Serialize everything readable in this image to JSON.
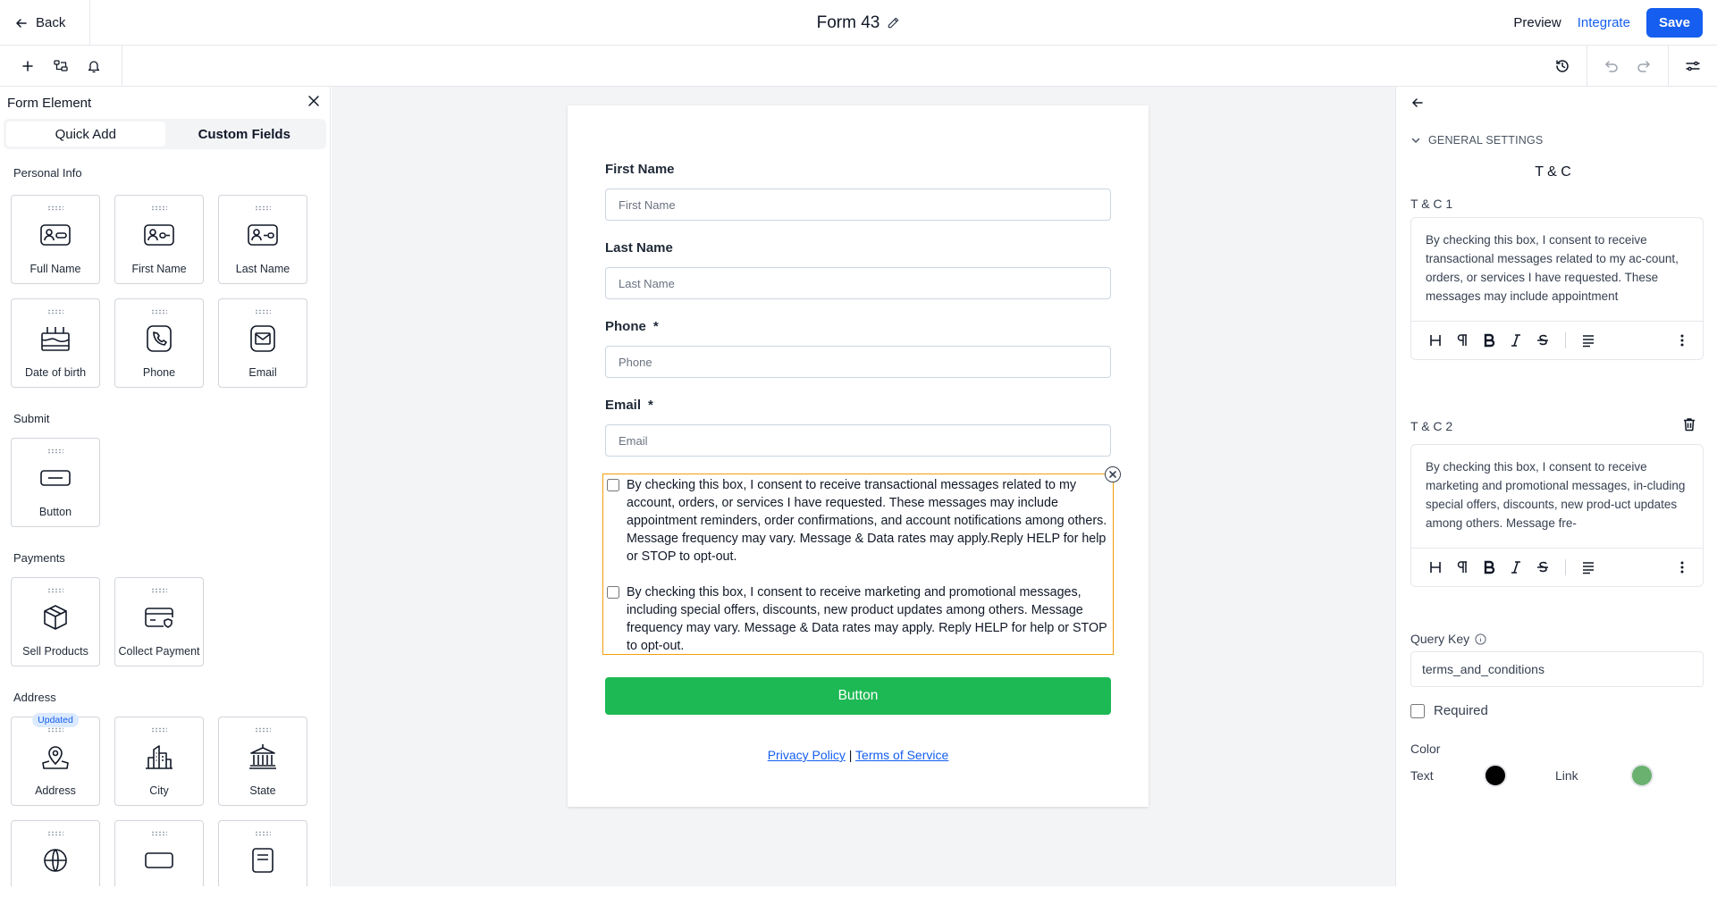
{
  "header": {
    "back_label": "Back",
    "form_title": "Form 43",
    "preview_label": "Preview",
    "integrate_label": "Integrate",
    "save_label": "Save"
  },
  "toolbar": {
    "left_icons": [
      "plus-icon",
      "layers-icon",
      "bell-icon"
    ],
    "right_icons": [
      "history-icon",
      "undo-icon",
      "redo-icon",
      "settings-sliders-icon"
    ]
  },
  "left_panel": {
    "title": "Form Element",
    "tabs": [
      {
        "label": "Quick Add",
        "active": true
      },
      {
        "label": "Custom Fields",
        "active": false
      }
    ],
    "sections": [
      {
        "label": "Personal Info",
        "items": [
          {
            "label": "Full Name",
            "icon": "id-card-icon"
          },
          {
            "label": "First Name",
            "icon": "id-card-icon"
          },
          {
            "label": "Last Name",
            "icon": "id-card-icon"
          },
          {
            "label": "Date of birth",
            "icon": "cake-icon"
          },
          {
            "label": "Phone",
            "icon": "phone-icon"
          },
          {
            "label": "Email",
            "icon": "mail-icon"
          }
        ]
      },
      {
        "label": "Submit",
        "items": [
          {
            "label": "Button",
            "icon": "button-icon"
          }
        ]
      },
      {
        "label": "Payments",
        "items": [
          {
            "label": "Sell Products",
            "icon": "box-icon"
          },
          {
            "label": "Collect Payment",
            "icon": "credit-card-icon"
          }
        ]
      },
      {
        "label": "Address",
        "items": [
          {
            "label": "Address",
            "icon": "map-pin-icon",
            "badge": "Updated"
          },
          {
            "label": "City",
            "icon": "city-icon"
          },
          {
            "label": "State",
            "icon": "landmark-icon"
          }
        ]
      }
    ]
  },
  "form": {
    "fields": [
      {
        "label": "First Name",
        "placeholder": "First Name",
        "required": false
      },
      {
        "label": "Last Name",
        "placeholder": "Last Name",
        "required": false
      },
      {
        "label": "Phone",
        "placeholder": "Phone",
        "required": true
      },
      {
        "label": "Email",
        "placeholder": "Email",
        "required": true
      }
    ],
    "required_marker": "*",
    "consents": [
      "By checking this box, I consent to receive transactional messages related to my account, orders, or services I have requested. These messages may include appointment reminders, order confirmations, and account notifications among others. Message frequency may vary. Message & Data rates may apply.Reply HELP for help or STOP to opt-out.",
      "By checking this box, I consent to receive marketing and promotional messages, including special offers, discounts, new product updates among others. Message frequency may vary. Message & Data rates may apply. Reply HELP for help or STOP to opt-out."
    ],
    "submit_label": "Button",
    "privacy_link": "Privacy Policy",
    "link_separator": "|",
    "terms_link": "Terms of Service"
  },
  "right_panel": {
    "section_label": "GENERAL SETTINGS",
    "heading": "T & C",
    "tc1": {
      "label": "T & C 1",
      "text": "By checking this box, I consent to receive transactional messages related to my ac-count, orders, or services I have requested. These messages may include appointment"
    },
    "tc2": {
      "label": "T & C 2",
      "text": "By checking this box, I consent to receive marketing and promotional messages, in-cluding special offers, discounts, new prod-uct updates among others. Message fre-"
    },
    "query_key_label": "Query Key",
    "query_key_value": "terms_and_conditions",
    "required_label": "Required",
    "color_label": "Color",
    "text_color_label": "Text",
    "link_color_label": "Link",
    "text_color": "#000000",
    "link_color": "#6ab06f"
  },
  "colors": {
    "accent": "#155eef",
    "submit_button": "#1db954",
    "selection_border": "#f59e0b"
  }
}
